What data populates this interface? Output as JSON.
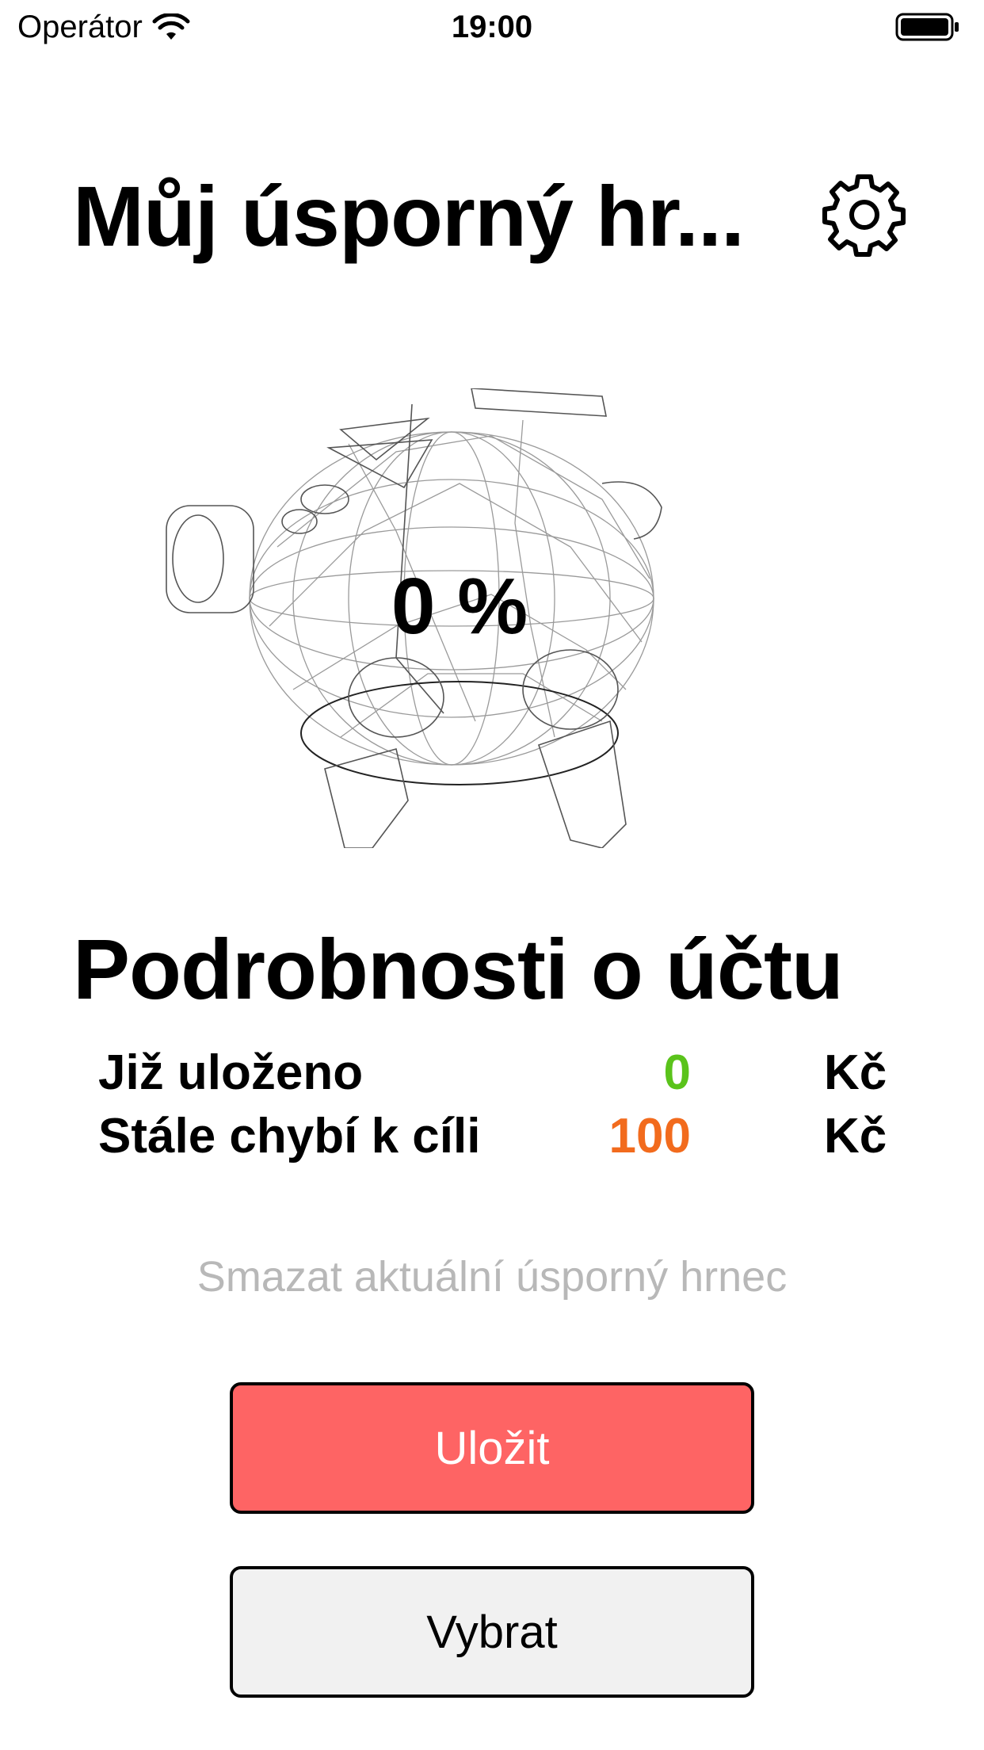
{
  "status_bar": {
    "carrier": "Operátor",
    "time": "19:00"
  },
  "header": {
    "title": "Můj úsporný hr..."
  },
  "progress": {
    "percent_label": "0 %",
    "percent": 0
  },
  "account": {
    "section_title": "Podrobnosti o účtu",
    "rows": [
      {
        "label": "Již uloženo",
        "value": "0",
        "unit": "Kč",
        "color": "#5ac31b"
      },
      {
        "label": "Stále chybí k cíli",
        "value": "100",
        "unit": "Kč",
        "color": "#f26b1d"
      }
    ]
  },
  "actions": {
    "delete_label": "Smazat aktuální úsporný hrnec",
    "save_label": "Uložit",
    "withdraw_label": "Vybrat"
  },
  "colors": {
    "save_button_bg": "#fe6464",
    "save_button_text": "#ffffff",
    "withdraw_button_bg": "#f1f1f1",
    "muted_text": "#b8b8b8"
  },
  "icons": {
    "settings": "gear-icon",
    "wifi": "wifi-icon",
    "battery": "battery-icon",
    "pig": "piggy-bank-wireframe"
  }
}
